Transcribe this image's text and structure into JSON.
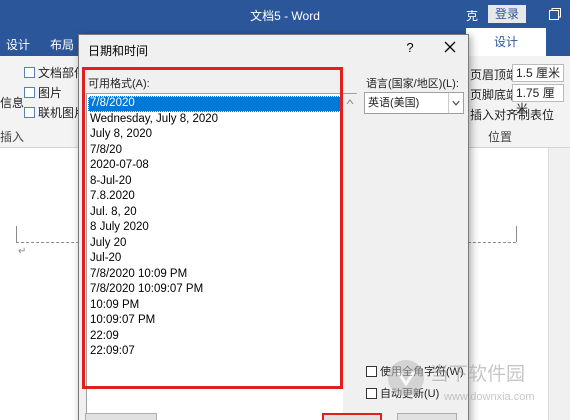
{
  "word": {
    "title": "文档5 - Word",
    "title_extra_char": "克",
    "login_label": "登录",
    "tabs": [
      "设计",
      "布局"
    ],
    "design_tab_right": "设计",
    "ribbon": {
      "items_col1": [
        "文档部件",
        "图片",
        "联机图片"
      ],
      "info_label": "信息",
      "insert_group": "插入",
      "header_from_top_label": "页眉顶端距离:",
      "header_from_top_value": "1.5 厘米",
      "footer_from_bottom_label": "页脚底端距离:",
      "footer_from_bottom_value": "1.75 厘米",
      "align_tab": "插入对齐制表位",
      "position_group": "位置"
    }
  },
  "dialog": {
    "title": "日期和时间",
    "help_label": "?",
    "available_formats_label": "可用格式(A):",
    "formats": [
      "7/8/2020",
      "Wednesday, July 8, 2020",
      "July 8, 2020",
      "7/8/20",
      "2020-07-08",
      "8-Jul-20",
      "7.8.2020",
      "Jul. 8, 20",
      "8 July 2020",
      "July 20",
      "Jul-20",
      "7/8/2020 10:09 PM",
      "7/8/2020 10:09:07 PM",
      "10:09 PM",
      "10:09:07 PM",
      "22:09",
      "22:09:07"
    ],
    "selected_index": 0,
    "language_label": "语言(国家/地区)(L):",
    "language_value": "英语(美国)",
    "fullwidth_checkbox": "使用全角字符(W)",
    "auto_update_checkbox": "自动更新(U)"
  },
  "colors": {
    "word_blue": "#2b579a",
    "highlight_red": "#e02020",
    "selection_blue": "#0078d7"
  },
  "watermark": {
    "text": "当下软件园",
    "url": "www.downxia.com"
  }
}
